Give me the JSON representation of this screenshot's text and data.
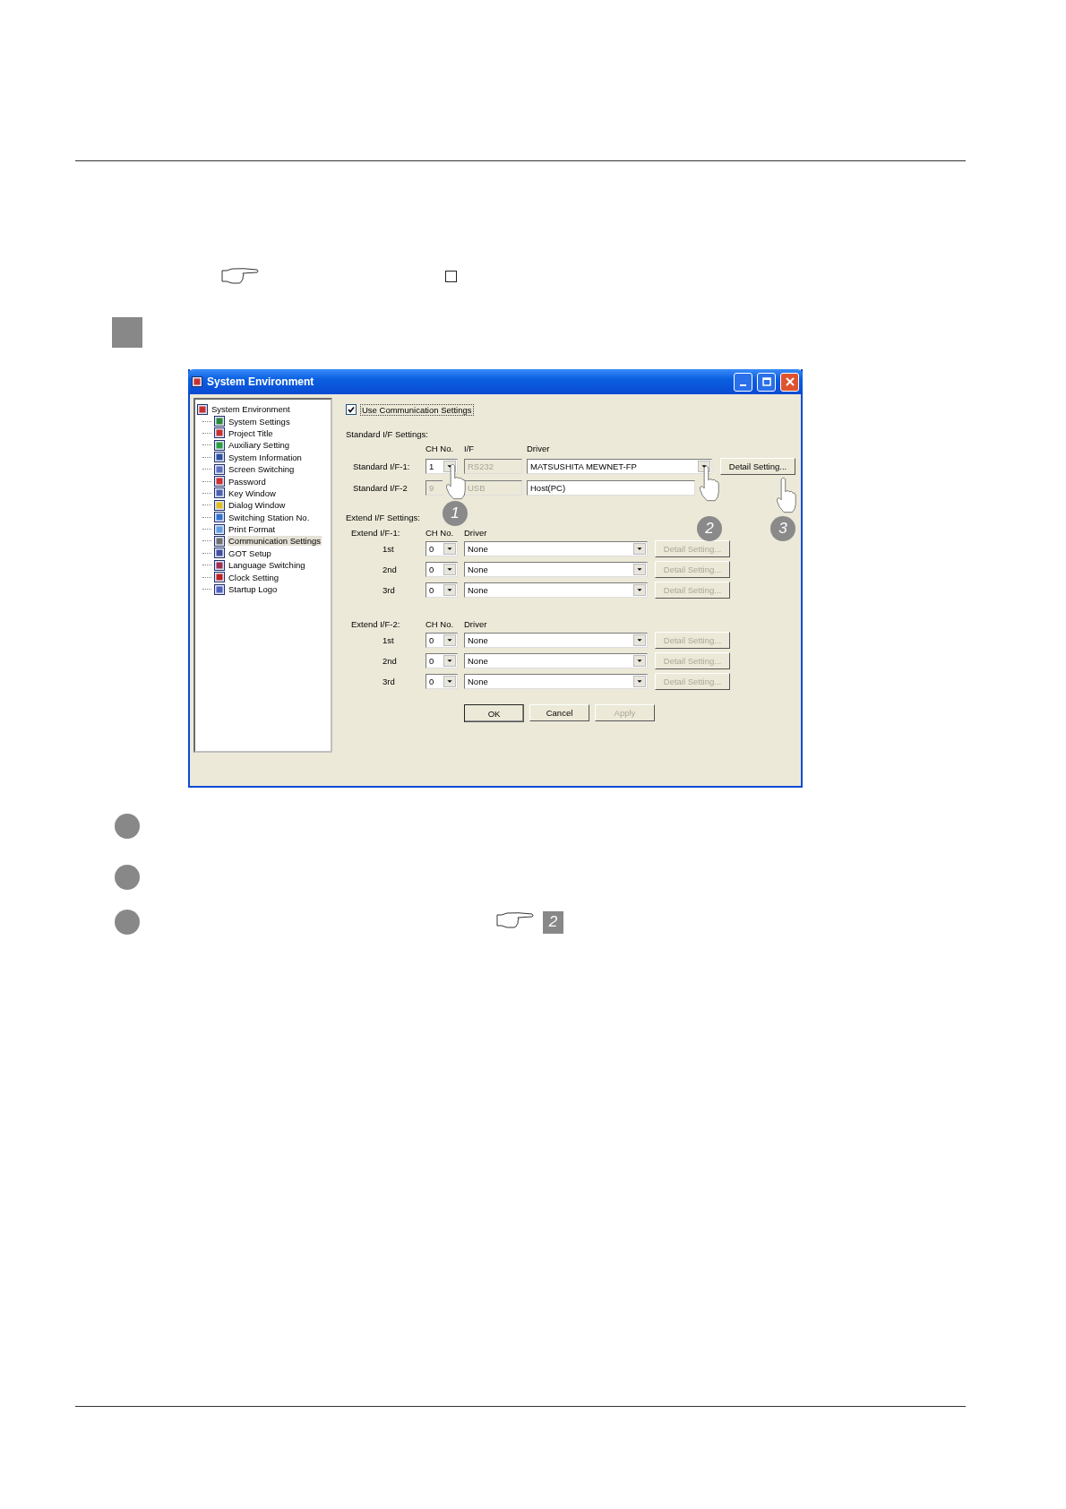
{
  "dialog": {
    "title": "System Environment",
    "tree": {
      "label": "System Environment",
      "children": [
        {
          "label": "System Settings",
          "selected": false
        },
        {
          "label": "Project Title",
          "selected": false
        },
        {
          "label": "Auxiliary Setting",
          "selected": false
        },
        {
          "label": "System Information",
          "selected": false
        },
        {
          "label": "Screen Switching",
          "selected": false
        },
        {
          "label": "Password",
          "selected": false
        },
        {
          "label": "Key Window",
          "selected": false
        },
        {
          "label": "Dialog Window",
          "selected": false
        },
        {
          "label": "Switching Station No.",
          "selected": false
        },
        {
          "label": "Print Format",
          "selected": false
        },
        {
          "label": "Communication Settings",
          "selected": true
        },
        {
          "label": "GOT Setup",
          "selected": false
        },
        {
          "label": "Language Switching",
          "selected": false
        },
        {
          "label": "Clock Setting",
          "selected": false
        },
        {
          "label": "Startup Logo",
          "selected": false
        }
      ]
    },
    "use_communication": {
      "label": "Use Communication Settings",
      "checked": true
    },
    "standard": {
      "title": "Standard I/F Settings:",
      "headers": [
        "CH No.",
        "I/F",
        "Driver"
      ],
      "rows": [
        {
          "label": "Standard I/F-1:",
          "ch": "1",
          "interface": "RS232",
          "driver": "MATSUSHITA MEWNET-FP",
          "dropdown": true,
          "disabled": false,
          "button": "Detail Setting..."
        },
        {
          "label": "Standard I/F-2",
          "ch": "9",
          "interface": "USB",
          "driver": "Host(PC)",
          "dropdown": false,
          "disabled": true
        }
      ]
    },
    "extend": {
      "title": "Extend I/F Settings:",
      "groups": [
        {
          "label": "Extend I/F-1:",
          "headers": [
            "CH No.",
            "Driver"
          ],
          "rows": [
            {
              "label": "1st",
              "ch": "0",
              "driver": "None",
              "button": "Detail Setting...",
              "disabled": true
            },
            {
              "label": "2nd",
              "ch": "0",
              "driver": "None",
              "button": "Detail Setting...",
              "disabled": true
            },
            {
              "label": "3rd",
              "ch": "0",
              "driver": "None",
              "button": "Detail Setting...",
              "disabled": true
            }
          ]
        },
        {
          "label": "Extend I/F-2:",
          "headers": [
            "CH No.",
            "Driver"
          ],
          "rows": [
            {
              "label": "1st",
              "ch": "0",
              "driver": "None",
              "button": "Detail Setting...",
              "disabled": true
            },
            {
              "label": "2nd",
              "ch": "0",
              "driver": "None",
              "button": "Detail Setting...",
              "disabled": true
            },
            {
              "label": "3rd",
              "ch": "0",
              "driver": "None",
              "button": "Detail Setting...",
              "disabled": true
            }
          ]
        }
      ]
    },
    "buttons": [
      {
        "label": "OK",
        "default": true,
        "disabled": false
      },
      {
        "label": "Cancel",
        "default": false,
        "disabled": false
      },
      {
        "label": "Apply",
        "default": false,
        "disabled": true
      }
    ],
    "callouts": [
      "1",
      "2",
      "3"
    ]
  },
  "reference": {
    "number": "2"
  }
}
